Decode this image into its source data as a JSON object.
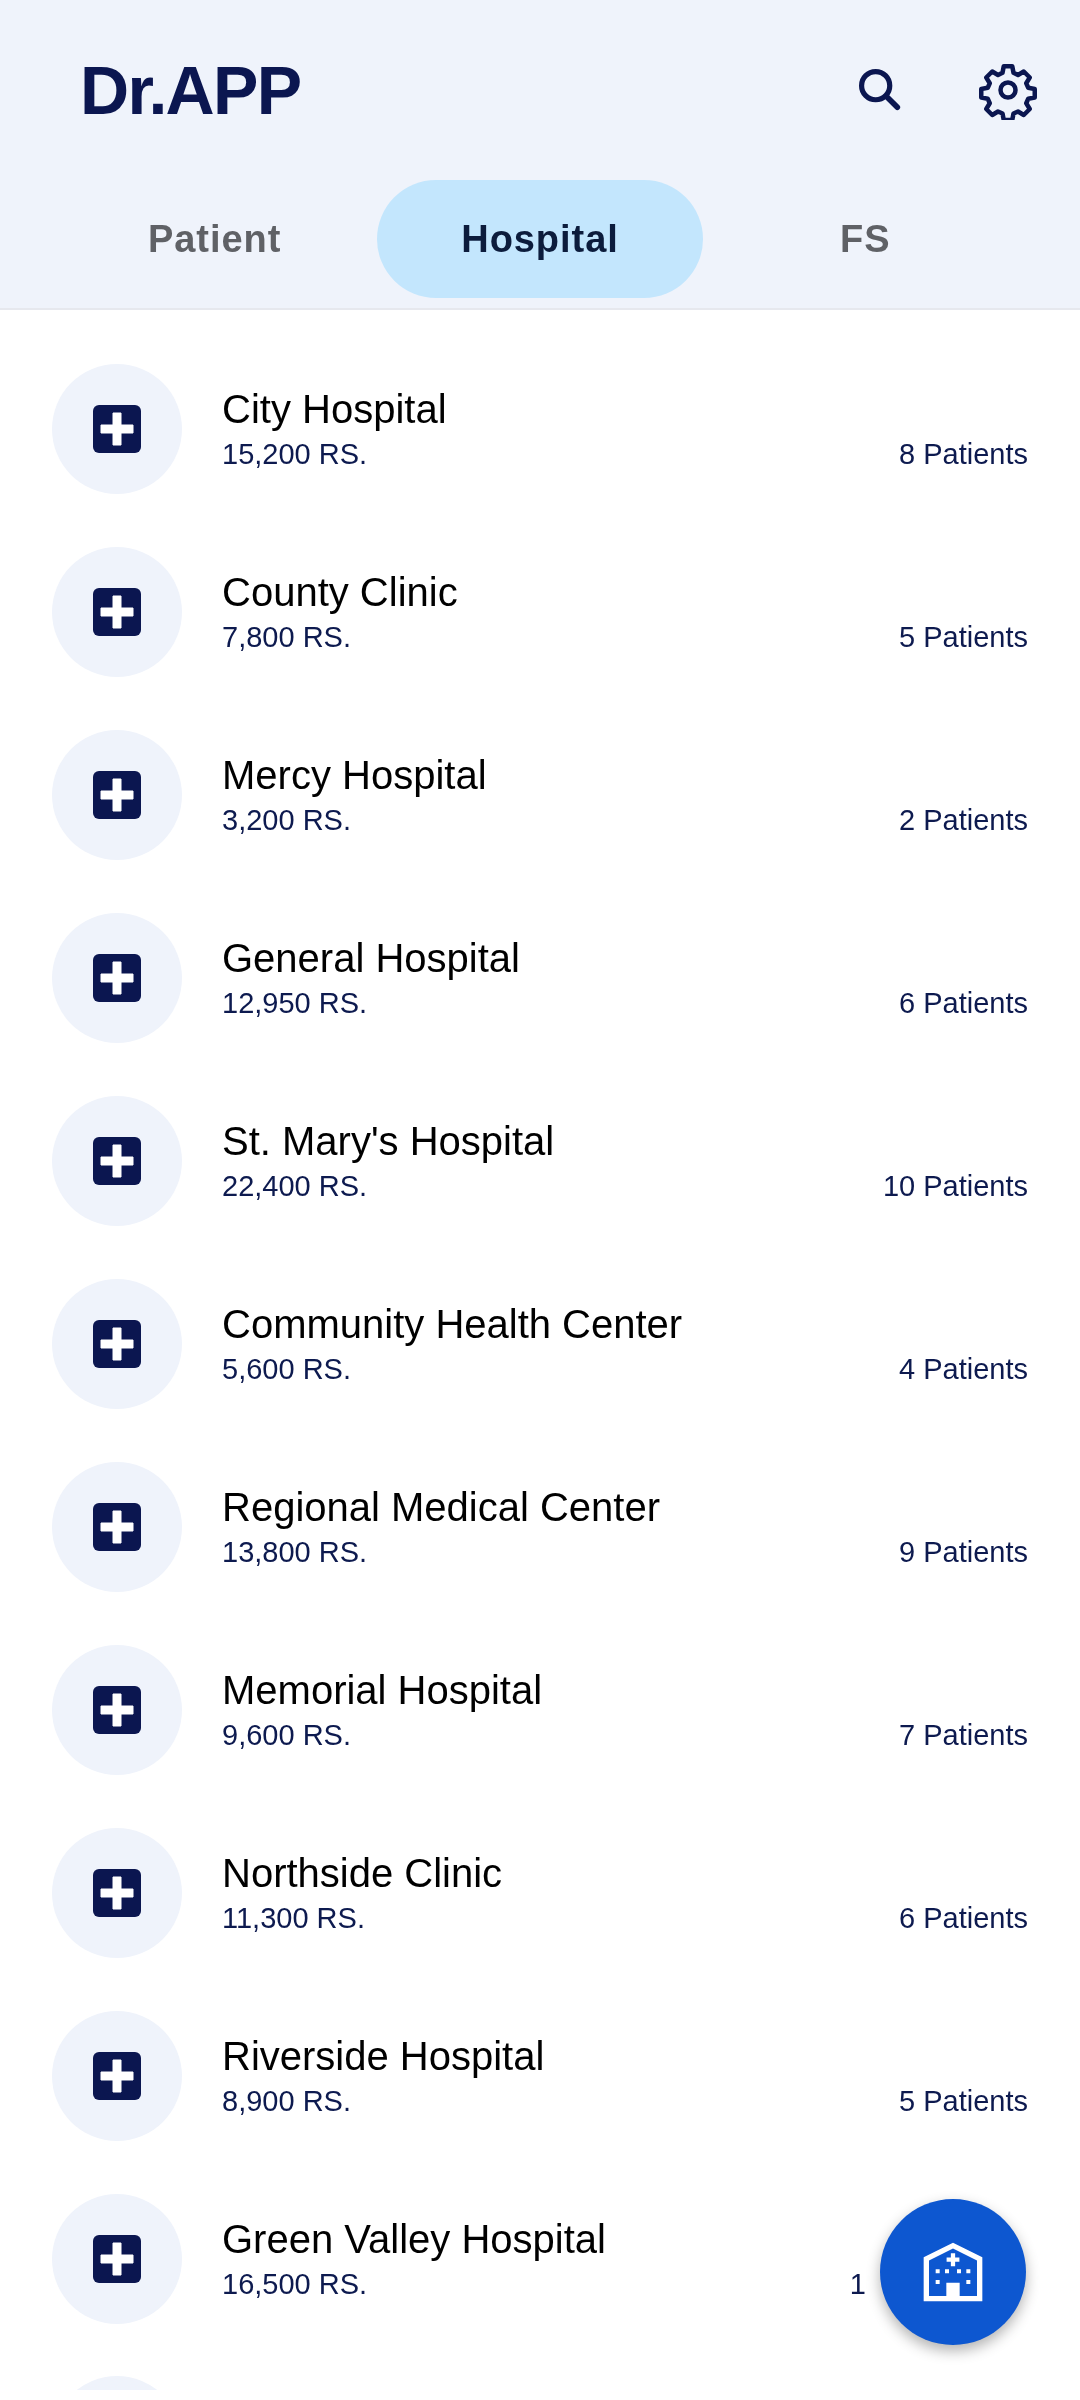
{
  "app_bar": {
    "title": "Dr.APP"
  },
  "tabs": [
    {
      "label": "Patient",
      "selected": false
    },
    {
      "label": "Hospital",
      "selected": true
    },
    {
      "label": "FS",
      "selected": false
    }
  ],
  "hospitals": [
    {
      "name": "City Hospital",
      "amount": "15,200 RS.",
      "patients": "8 Patients"
    },
    {
      "name": "County Clinic",
      "amount": "7,800 RS.",
      "patients": "5 Patients"
    },
    {
      "name": "Mercy Hospital",
      "amount": "3,200 RS.",
      "patients": "2 Patients"
    },
    {
      "name": "General Hospital",
      "amount": "12,950 RS.",
      "patients": "6 Patients"
    },
    {
      "name": "St. Mary's Hospital",
      "amount": "22,400 RS.",
      "patients": "10 Patients"
    },
    {
      "name": "Community Health Center",
      "amount": "5,600 RS.",
      "patients": "4 Patients"
    },
    {
      "name": "Regional Medical Center",
      "amount": "13,800 RS.",
      "patients": "9 Patients"
    },
    {
      "name": "Memorial Hospital",
      "amount": "9,600 RS.",
      "patients": "7 Patients"
    },
    {
      "name": "Northside Clinic",
      "amount": "11,300 RS.",
      "patients": "6 Patients"
    },
    {
      "name": "Riverside Hospital",
      "amount": "8,900 RS.",
      "patients": "5 Patients"
    },
    {
      "name": "Green Valley Hospital",
      "amount": "16,500 RS.",
      "patients": "1",
      "covered": true
    }
  ]
}
